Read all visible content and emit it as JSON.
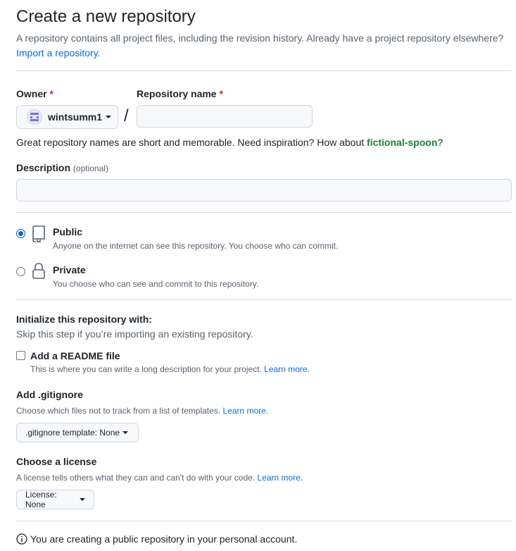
{
  "header": {
    "title": "Create a new repository",
    "subtitle": "A repository contains all project files, including the revision history. Already have a project repository elsewhere?",
    "import_link": "Import a repository."
  },
  "owner": {
    "label": "Owner",
    "required_mark": "*",
    "value": "wintsumm1"
  },
  "repo_name": {
    "label": "Repository name",
    "required_mark": "*",
    "value": ""
  },
  "name_hint": {
    "prefix": "Great repository names are short and memorable. Need inspiration? How about ",
    "suggestion": "fictional-spoon",
    "suffix": "?"
  },
  "description": {
    "label": "Description",
    "optional": "(optional)",
    "value": ""
  },
  "visibility": {
    "public_title": "Public",
    "public_desc": "Anyone on the internet can see this repository. You choose who can commit.",
    "private_title": "Private",
    "private_desc": "You choose who can see and commit to this repository.",
    "selected": "public"
  },
  "initialize": {
    "title": "Initialize this repository with:",
    "subtitle": "Skip this step if you’re importing an existing repository.",
    "readme_label": "Add a README file",
    "readme_desc": "This is where you can write a long description for your project.",
    "learn_more": "Learn more."
  },
  "gitignore": {
    "title": "Add .gitignore",
    "desc": "Choose which files not to track from a list of templates.",
    "learn_more": "Learn more.",
    "button_label": ".gitignore template: None"
  },
  "license": {
    "title": "Choose a license",
    "desc": "A license tells others what they can and can't do with your code.",
    "learn_more": "Learn more.",
    "button_label": "License: None"
  },
  "footer_note": "You are creating a public repository in your personal account.",
  "colors": {
    "link": "#0969da",
    "required": "#d1242f",
    "suggestion": "#1a7f37"
  }
}
